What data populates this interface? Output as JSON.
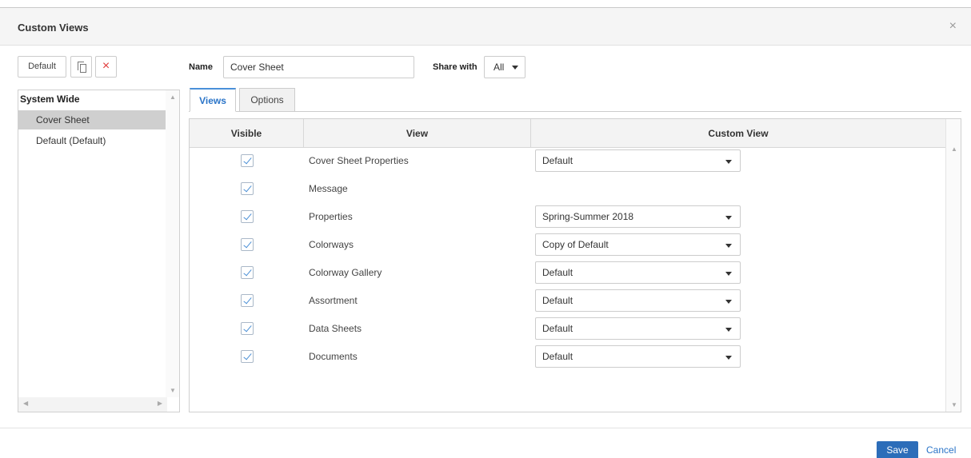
{
  "dialog": {
    "title": "Custom Views",
    "close_icon": "×"
  },
  "toolbar": {
    "default_label": "Default",
    "copy_icon": "copy-icon",
    "delete_icon": "×"
  },
  "tree": {
    "group_label": "System Wide",
    "items": [
      {
        "label": "Cover Sheet",
        "selected": true
      },
      {
        "label": "Default (Default)",
        "selected": false
      }
    ]
  },
  "form": {
    "name_label": "Name",
    "name_value": "Cover Sheet",
    "share_label": "Share with",
    "share_value": "All"
  },
  "tabs": [
    {
      "label": "Views",
      "active": true
    },
    {
      "label": "Options",
      "active": false
    }
  ],
  "grid": {
    "headers": {
      "visible": "Visible",
      "view": "View",
      "custom_view": "Custom View"
    },
    "rows": [
      {
        "visible": true,
        "view": "Cover Sheet Properties",
        "custom_view": "Default"
      },
      {
        "visible": true,
        "view": "Message",
        "custom_view": null
      },
      {
        "visible": true,
        "view": "Properties",
        "custom_view": "Spring-Summer 2018"
      },
      {
        "visible": true,
        "view": "Colorways",
        "custom_view": "Copy of Default"
      },
      {
        "visible": true,
        "view": "Colorway Gallery",
        "custom_view": "Default"
      },
      {
        "visible": true,
        "view": "Assortment",
        "custom_view": "Default"
      },
      {
        "visible": true,
        "view": "Data Sheets",
        "custom_view": "Default"
      },
      {
        "visible": true,
        "view": "Documents",
        "custom_view": "Default"
      }
    ]
  },
  "footer": {
    "save_label": "Save",
    "cancel_label": "Cancel"
  },
  "colors": {
    "accent": "#2c6db9",
    "link": "#2a74c8",
    "delete": "#e03a3a",
    "selected_row": "#cfcfcf"
  }
}
